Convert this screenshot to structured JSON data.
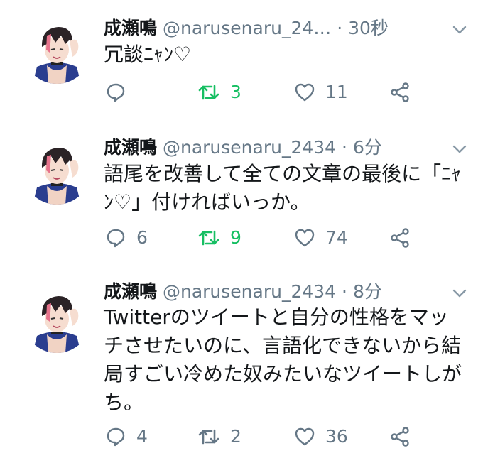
{
  "colors": {
    "text": "#14171a",
    "secondary": "#657786",
    "retweet_active": "#17bf63",
    "divider": "#e1e8ed"
  },
  "tweets": [
    {
      "name": "成瀬鳴",
      "handle": "@narusenaru_24…",
      "separator": "·",
      "time": "30秒",
      "text": "冗談ﾆｬﾝ♡",
      "reply_count": "",
      "retweet_count": "3",
      "retweet_active": true,
      "like_count": "11"
    },
    {
      "name": "成瀬鳴",
      "handle": "@narusenaru_2434",
      "separator": "·",
      "time": "6分",
      "text": "語尾を改善して全ての文章の最後に「ﾆｬﾝ♡」付ければいっか。",
      "reply_count": "6",
      "retweet_count": "9",
      "retweet_active": true,
      "like_count": "74"
    },
    {
      "name": "成瀬鳴",
      "handle": "@narusenaru_2434",
      "separator": "·",
      "time": "8分",
      "text": "Twitterのツイートと自分の性格をマッチさせたいのに、言語化できないから結局すごい冷めた奴みたいなツイートしがち。",
      "reply_count": "4",
      "retweet_count": "2",
      "retweet_active": false,
      "like_count": "36"
    }
  ]
}
